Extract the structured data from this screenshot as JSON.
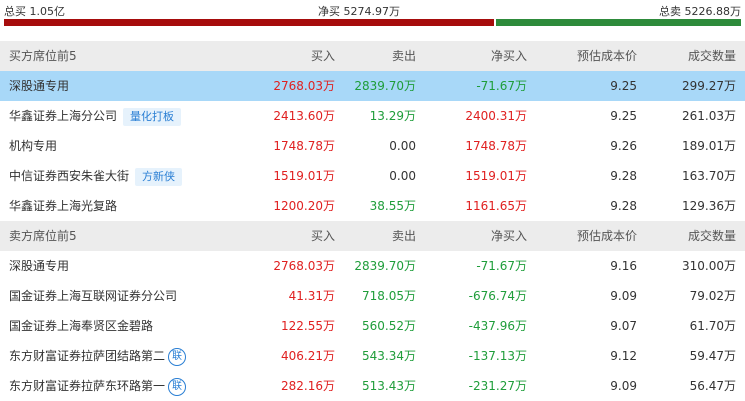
{
  "summary": {
    "total_buy": "总买 1.05亿",
    "net_buy": "净买 5274.97万",
    "total_sell": "总卖 5226.88万",
    "buy_bar_color": "#a60c0c",
    "sell_bar_color": "#2e8b3b"
  },
  "buy_section": {
    "headers": [
      "买方席位前5",
      "买入",
      "卖出",
      "净买入",
      "预估成本价",
      "成交数量"
    ],
    "rows": [
      {
        "name": "深股通专用",
        "tag": "",
        "badge": "",
        "buy": "2768.03万",
        "sell": "2839.70万",
        "net": "-71.67万",
        "cost": "9.25",
        "volume": "299.27万"
      },
      {
        "name": "华鑫证券上海分公司",
        "tag": "量化打板",
        "badge": "",
        "buy": "2413.60万",
        "sell": "13.29万",
        "net": "2400.31万",
        "cost": "9.25",
        "volume": "261.03万"
      },
      {
        "name": "机构专用",
        "tag": "",
        "badge": "",
        "buy": "1748.78万",
        "sell": "0.00",
        "net": "1748.78万",
        "cost": "9.26",
        "volume": "189.01万"
      },
      {
        "name": "中信证券西安朱雀大街",
        "tag": "方新侠",
        "badge": "",
        "buy": "1519.01万",
        "sell": "0.00",
        "net": "1519.01万",
        "cost": "9.28",
        "volume": "163.70万"
      },
      {
        "name": "华鑫证券上海光复路",
        "tag": "",
        "badge": "",
        "buy": "1200.20万",
        "sell": "38.55万",
        "net": "1161.65万",
        "cost": "9.28",
        "volume": "129.36万"
      }
    ]
  },
  "sell_section": {
    "headers": [
      "卖方席位前5",
      "买入",
      "卖出",
      "净买入",
      "预估成本价",
      "成交数量"
    ],
    "rows": [
      {
        "name": "深股通专用",
        "tag": "",
        "badge": "",
        "buy": "2768.03万",
        "sell": "2839.70万",
        "net": "-71.67万",
        "cost": "9.16",
        "volume": "310.00万"
      },
      {
        "name": "国金证券上海互联网证券分公司",
        "tag": "",
        "badge": "",
        "buy": "41.31万",
        "sell": "718.05万",
        "net": "-676.74万",
        "cost": "9.09",
        "volume": "79.02万"
      },
      {
        "name": "国金证券上海奉贤区金碧路",
        "tag": "",
        "badge": "",
        "buy": "122.55万",
        "sell": "560.52万",
        "net": "-437.96万",
        "cost": "9.07",
        "volume": "61.70万"
      },
      {
        "name": "东方财富证券拉萨团结路第二",
        "tag": "",
        "badge": "联",
        "buy": "406.21万",
        "sell": "543.34万",
        "net": "-137.13万",
        "cost": "9.12",
        "volume": "59.47万"
      },
      {
        "name": "东方财富证券拉萨东环路第一",
        "tag": "",
        "badge": "联",
        "buy": "282.16万",
        "sell": "513.43万",
        "net": "-231.27万",
        "cost": "9.09",
        "volume": "56.47万"
      }
    ]
  }
}
